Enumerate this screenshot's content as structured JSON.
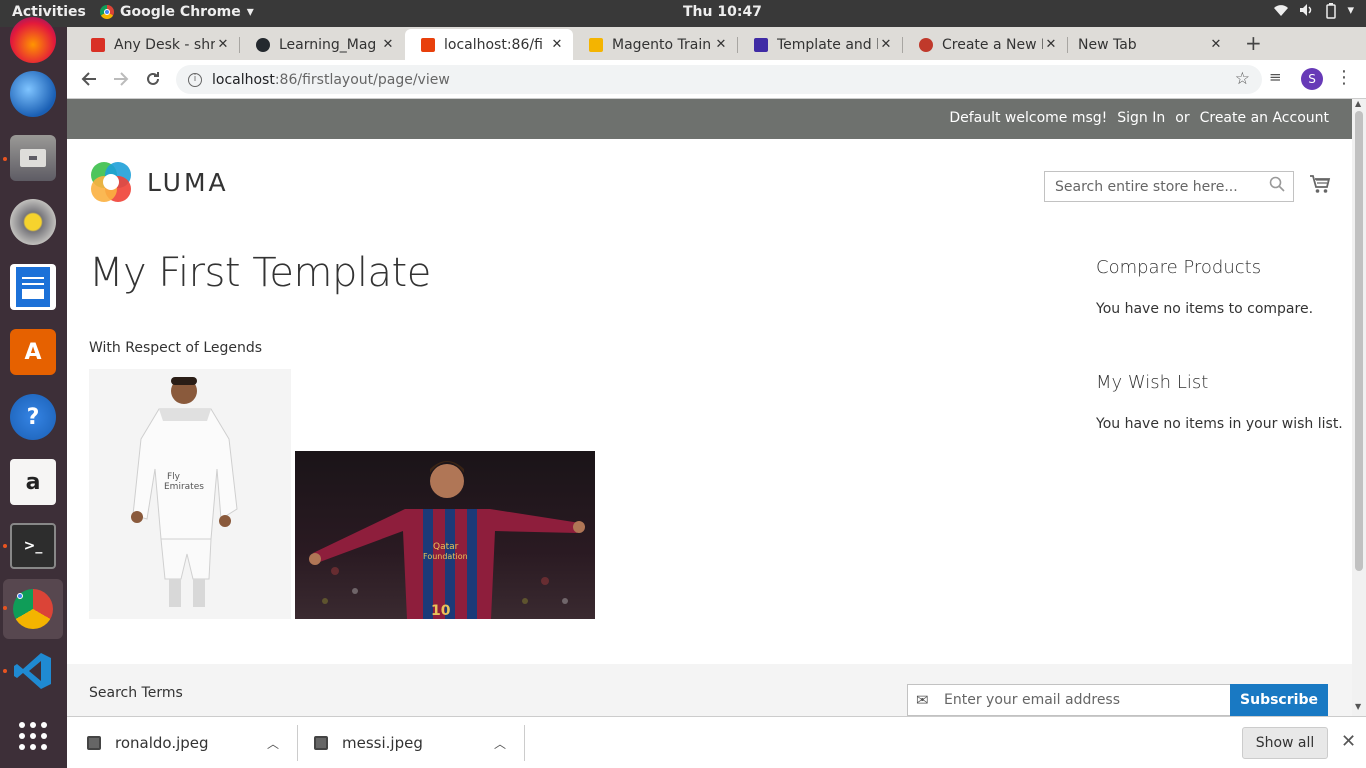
{
  "system": {
    "activities": "Activities",
    "app_name": "Google Chrome",
    "clock": "Thu 10:47"
  },
  "tabs": [
    {
      "title": "Any Desk - shre",
      "favicon_color": "#d93025"
    },
    {
      "title": "Learning_Mag",
      "favicon_color": "#24292e"
    },
    {
      "title": "localhost:86/fi",
      "favicon_color": "#e8400c",
      "active": true
    },
    {
      "title": "Magento Train",
      "favicon_color": "#f4b400"
    },
    {
      "title": "Template and l",
      "favicon_color": "#3f2ba5"
    },
    {
      "title": "Create a New M",
      "favicon_color": "#c0392b"
    },
    {
      "title": "New Tab",
      "favicon_color": ""
    }
  ],
  "address": {
    "host": "localhost",
    "path": ":86/firstlayout/page/view"
  },
  "profile_initial": "S",
  "store": {
    "welcome": "Default welcome msg!",
    "sign_in": "Sign In",
    "or": "or",
    "create_account": "Create an Account",
    "logo_text": "LUMA",
    "search_placeholder": "Search entire store here..."
  },
  "main": {
    "title": "My First Template",
    "subtitle": "With Respect of Legends"
  },
  "sidebar": {
    "compare_title": "Compare Products",
    "compare_text": "You have no items to compare.",
    "wishlist_title": "My Wish List",
    "wishlist_text": "You have no items in your wish list."
  },
  "footer": {
    "search_terms": "Search Terms",
    "email_placeholder": "Enter your email address",
    "subscribe": "Subscribe"
  },
  "downloads": {
    "items": [
      "ronaldo.jpeg",
      "messi.jpeg"
    ],
    "show_all": "Show all"
  },
  "colors": {
    "accent": "#1979c3",
    "panel_header": "#6e716e",
    "dock": "#3d2f38"
  }
}
